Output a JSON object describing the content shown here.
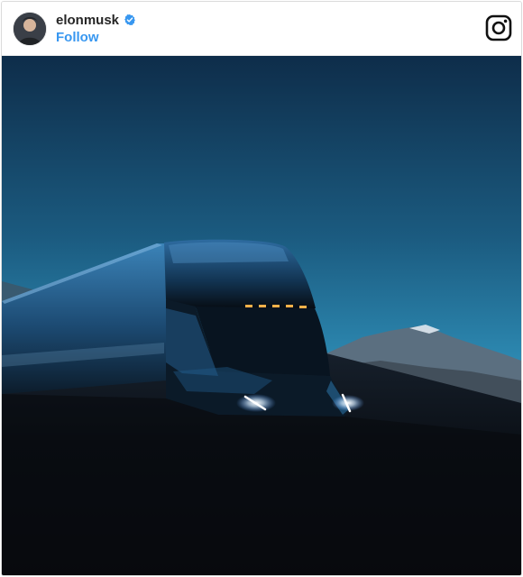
{
  "post": {
    "username": "elonmusk",
    "verified": true,
    "follow_label": "Follow",
    "platform_icon": "instagram-icon",
    "avatar_icon": "profile-avatar",
    "media_description_icon": "photo-media"
  },
  "colors": {
    "username": "#262626",
    "follow": "#3897f0",
    "verified_badge": "#3897f0",
    "sky_top": "#0e2d4a",
    "sky_bottom": "#2f8fb8",
    "ground": "#0a0d12"
  }
}
